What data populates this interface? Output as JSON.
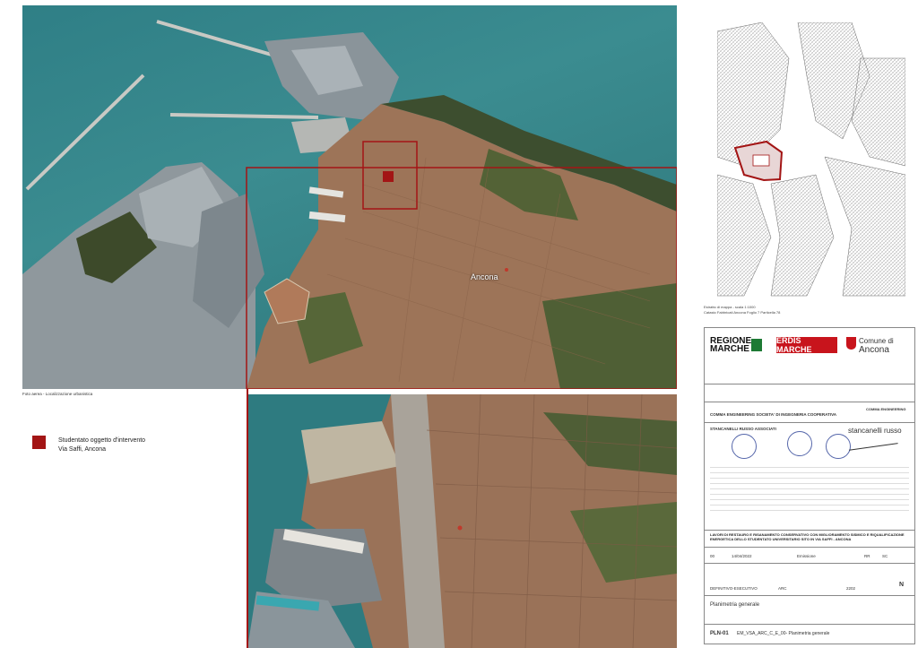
{
  "aerial_caption": "Foto aerea - Localizzazione urbanistica",
  "map_place_label": "Ancona",
  "legend": {
    "swatch_color": "#a31515",
    "line1": "Studentato oggetto d'intervento",
    "line2": "Via Saffi, Ancona"
  },
  "cadastral": {
    "caption_line1": "Estratto di mappa - scala 1:1000",
    "caption_line2": "Catasto Fabbricati Ancona Foglio 7 Particella 78"
  },
  "title_block": {
    "client_logos": {
      "regione": "REGIONE MARCHE",
      "erdis": "ERDIS MARCHE",
      "comune_line1": "Comune di",
      "comune_line2": "Ancona"
    },
    "company": "COMMA ENGINEERING SOCIETA' DI INGEGNERIA COOPERATIVA",
    "company_logo": "COMMA ENGINEERING",
    "associates": "STANCANELLI RUSSO ASSOCIATI",
    "associates_logo": "stancanelli russo",
    "project_title": "LAVORI DI RESTAURO E RISANAMENTO CONSERVATIVO CON MIGLIORAMENTO SISMICO E RIQUALIFICAZIONE ENERGETICA DELLO STUDENTATO UNIVERSITARIO SITO IN VIA SAFFI - ANCONA",
    "revision": {
      "number": "00",
      "date": "14/04/2022",
      "description": "Emissione",
      "col4": "RR",
      "col5": "SC"
    },
    "phase": "DEFINITIVO-ESECUTIVO",
    "discipline": "ARC",
    "code": "2202",
    "drawing_title": "Planimetria generale",
    "sheet_id": "PLN-01",
    "file_name": "EM_VSA_ARC_C_E_00- Planimetria generale",
    "north_symbol": "N"
  }
}
